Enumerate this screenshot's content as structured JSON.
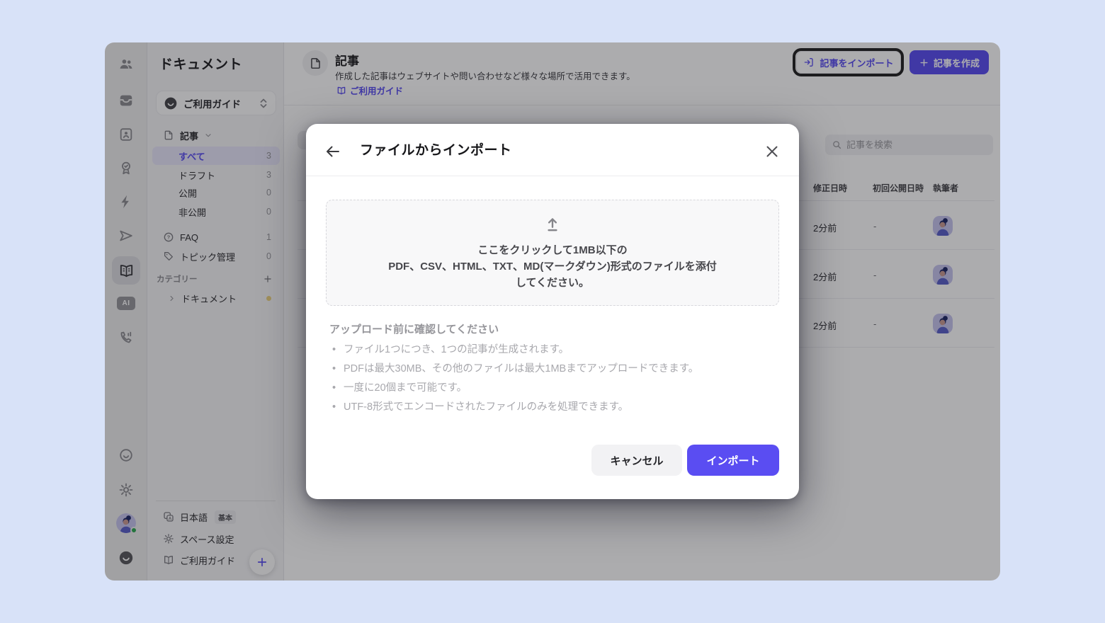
{
  "colors": {
    "accent": "#5a4df2",
    "page_background": "#d8e2f8",
    "highlight_ring": "#1c1c1e",
    "status_green": "#2faa52",
    "category_dot": "#ecd27f"
  },
  "rail": {
    "ai_label": "AI",
    "icons": [
      "people-icon",
      "inbox-icon",
      "contact-card-icon",
      "badge-check-icon",
      "bolt-icon",
      "send-icon",
      "book-open-icon",
      "ai-icon",
      "phone-icon",
      "smiley-icon",
      "gear-icon",
      "avatar",
      "logo-icon"
    ]
  },
  "sidebar": {
    "title": "ドキュメント",
    "workspace": {
      "label": "ご利用ガイド"
    },
    "article_section": {
      "label": "記事"
    },
    "items": [
      {
        "label": "すべて",
        "count": "3"
      },
      {
        "label": "ドラフト",
        "count": "3"
      },
      {
        "label": "公開",
        "count": "0"
      },
      {
        "label": "非公開",
        "count": "0"
      }
    ],
    "faq": {
      "label": "FAQ",
      "count": "1"
    },
    "topics": {
      "label": "トピック管理",
      "count": "0"
    },
    "category_label": "カテゴリー",
    "category_item": {
      "label": "ドキュメント"
    },
    "footer": {
      "language": {
        "label": "日本語",
        "badge": "基本"
      },
      "space_settings": {
        "label": "スペース設定"
      },
      "guide": {
        "label": "ご利用ガイド"
      }
    }
  },
  "header": {
    "title": "記事",
    "description": "作成した記事はウェブサイトや問い合わせなど様々な場所で活用できます。",
    "guide_link": "ご利用ガイド",
    "import_button": "記事をインポート",
    "create_button": "記事を作成"
  },
  "content": {
    "search_placeholder": "記事を検索",
    "columns": [
      "修正日時",
      "初回公開日時",
      "執筆者"
    ],
    "rows": [
      {
        "modified": "2分前",
        "first_published": "-"
      },
      {
        "modified": "2分前",
        "first_published": "-"
      },
      {
        "modified": "2分前",
        "first_published": "-"
      }
    ]
  },
  "modal": {
    "title": "ファイルからインポート",
    "dropzone_lines": [
      "ここをクリックして1MB以下の",
      "PDF、CSV、HTML、TXT、MD(マークダウン)形式のファイルを添付",
      "してください。"
    ],
    "checklist_title": "アップロード前に確認してください",
    "checklist": [
      "ファイル1つにつき、1つの記事が生成されます。",
      "PDFは最大30MB、その他のファイルは最大1MBまでアップロードできます。",
      "一度に20個まで可能です。",
      "UTF-8形式でエンコードされたファイルのみを処理できます。"
    ],
    "cancel_label": "キャンセル",
    "confirm_label": "インポート"
  }
}
